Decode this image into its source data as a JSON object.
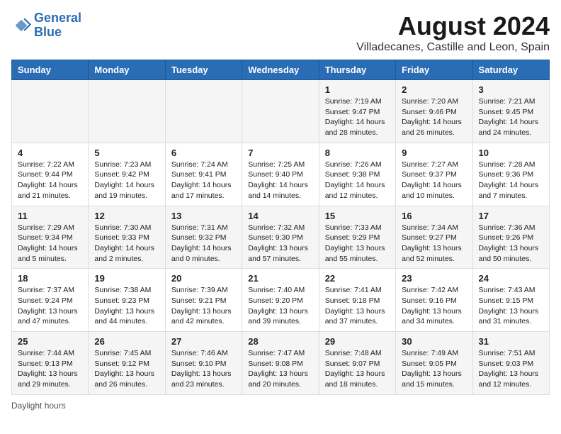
{
  "header": {
    "logo_general": "General",
    "logo_blue": "Blue",
    "month_year": "August 2024",
    "location": "Villadecanes, Castille and Leon, Spain"
  },
  "days_of_week": [
    "Sunday",
    "Monday",
    "Tuesday",
    "Wednesday",
    "Thursday",
    "Friday",
    "Saturday"
  ],
  "weeks": [
    [
      {
        "day": "",
        "info": ""
      },
      {
        "day": "",
        "info": ""
      },
      {
        "day": "",
        "info": ""
      },
      {
        "day": "",
        "info": ""
      },
      {
        "day": "1",
        "info": "Sunrise: 7:19 AM\nSunset: 9:47 PM\nDaylight: 14 hours\nand 28 minutes."
      },
      {
        "day": "2",
        "info": "Sunrise: 7:20 AM\nSunset: 9:46 PM\nDaylight: 14 hours\nand 26 minutes."
      },
      {
        "day": "3",
        "info": "Sunrise: 7:21 AM\nSunset: 9:45 PM\nDaylight: 14 hours\nand 24 minutes."
      }
    ],
    [
      {
        "day": "4",
        "info": "Sunrise: 7:22 AM\nSunset: 9:44 PM\nDaylight: 14 hours\nand 21 minutes."
      },
      {
        "day": "5",
        "info": "Sunrise: 7:23 AM\nSunset: 9:42 PM\nDaylight: 14 hours\nand 19 minutes."
      },
      {
        "day": "6",
        "info": "Sunrise: 7:24 AM\nSunset: 9:41 PM\nDaylight: 14 hours\nand 17 minutes."
      },
      {
        "day": "7",
        "info": "Sunrise: 7:25 AM\nSunset: 9:40 PM\nDaylight: 14 hours\nand 14 minutes."
      },
      {
        "day": "8",
        "info": "Sunrise: 7:26 AM\nSunset: 9:38 PM\nDaylight: 14 hours\nand 12 minutes."
      },
      {
        "day": "9",
        "info": "Sunrise: 7:27 AM\nSunset: 9:37 PM\nDaylight: 14 hours\nand 10 minutes."
      },
      {
        "day": "10",
        "info": "Sunrise: 7:28 AM\nSunset: 9:36 PM\nDaylight: 14 hours\nand 7 minutes."
      }
    ],
    [
      {
        "day": "11",
        "info": "Sunrise: 7:29 AM\nSunset: 9:34 PM\nDaylight: 14 hours\nand 5 minutes."
      },
      {
        "day": "12",
        "info": "Sunrise: 7:30 AM\nSunset: 9:33 PM\nDaylight: 14 hours\nand 2 minutes."
      },
      {
        "day": "13",
        "info": "Sunrise: 7:31 AM\nSunset: 9:32 PM\nDaylight: 14 hours\nand 0 minutes."
      },
      {
        "day": "14",
        "info": "Sunrise: 7:32 AM\nSunset: 9:30 PM\nDaylight: 13 hours\nand 57 minutes."
      },
      {
        "day": "15",
        "info": "Sunrise: 7:33 AM\nSunset: 9:29 PM\nDaylight: 13 hours\nand 55 minutes."
      },
      {
        "day": "16",
        "info": "Sunrise: 7:34 AM\nSunset: 9:27 PM\nDaylight: 13 hours\nand 52 minutes."
      },
      {
        "day": "17",
        "info": "Sunrise: 7:36 AM\nSunset: 9:26 PM\nDaylight: 13 hours\nand 50 minutes."
      }
    ],
    [
      {
        "day": "18",
        "info": "Sunrise: 7:37 AM\nSunset: 9:24 PM\nDaylight: 13 hours\nand 47 minutes."
      },
      {
        "day": "19",
        "info": "Sunrise: 7:38 AM\nSunset: 9:23 PM\nDaylight: 13 hours\nand 44 minutes."
      },
      {
        "day": "20",
        "info": "Sunrise: 7:39 AM\nSunset: 9:21 PM\nDaylight: 13 hours\nand 42 minutes."
      },
      {
        "day": "21",
        "info": "Sunrise: 7:40 AM\nSunset: 9:20 PM\nDaylight: 13 hours\nand 39 minutes."
      },
      {
        "day": "22",
        "info": "Sunrise: 7:41 AM\nSunset: 9:18 PM\nDaylight: 13 hours\nand 37 minutes."
      },
      {
        "day": "23",
        "info": "Sunrise: 7:42 AM\nSunset: 9:16 PM\nDaylight: 13 hours\nand 34 minutes."
      },
      {
        "day": "24",
        "info": "Sunrise: 7:43 AM\nSunset: 9:15 PM\nDaylight: 13 hours\nand 31 minutes."
      }
    ],
    [
      {
        "day": "25",
        "info": "Sunrise: 7:44 AM\nSunset: 9:13 PM\nDaylight: 13 hours\nand 29 minutes."
      },
      {
        "day": "26",
        "info": "Sunrise: 7:45 AM\nSunset: 9:12 PM\nDaylight: 13 hours\nand 26 minutes."
      },
      {
        "day": "27",
        "info": "Sunrise: 7:46 AM\nSunset: 9:10 PM\nDaylight: 13 hours\nand 23 minutes."
      },
      {
        "day": "28",
        "info": "Sunrise: 7:47 AM\nSunset: 9:08 PM\nDaylight: 13 hours\nand 20 minutes."
      },
      {
        "day": "29",
        "info": "Sunrise: 7:48 AM\nSunset: 9:07 PM\nDaylight: 13 hours\nand 18 minutes."
      },
      {
        "day": "30",
        "info": "Sunrise: 7:49 AM\nSunset: 9:05 PM\nDaylight: 13 hours\nand 15 minutes."
      },
      {
        "day": "31",
        "info": "Sunrise: 7:51 AM\nSunset: 9:03 PM\nDaylight: 13 hours\nand 12 minutes."
      }
    ]
  ],
  "footer": {
    "daylight_label": "Daylight hours"
  }
}
